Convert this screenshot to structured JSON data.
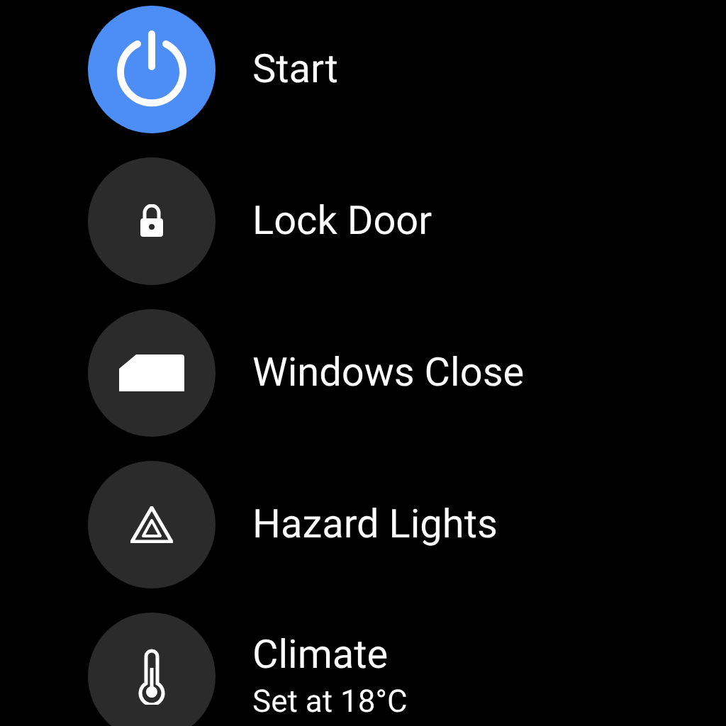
{
  "actions": [
    {
      "kind": "power",
      "label": "Start",
      "active": true
    },
    {
      "kind": "lock",
      "label": "Lock Door",
      "active": false
    },
    {
      "kind": "window",
      "label": "Windows Close",
      "active": false
    },
    {
      "kind": "hazard",
      "label": "Hazard Lights",
      "active": false
    },
    {
      "kind": "thermometer",
      "label": "Climate",
      "detail": "Set at 18°C",
      "active": false
    }
  ]
}
